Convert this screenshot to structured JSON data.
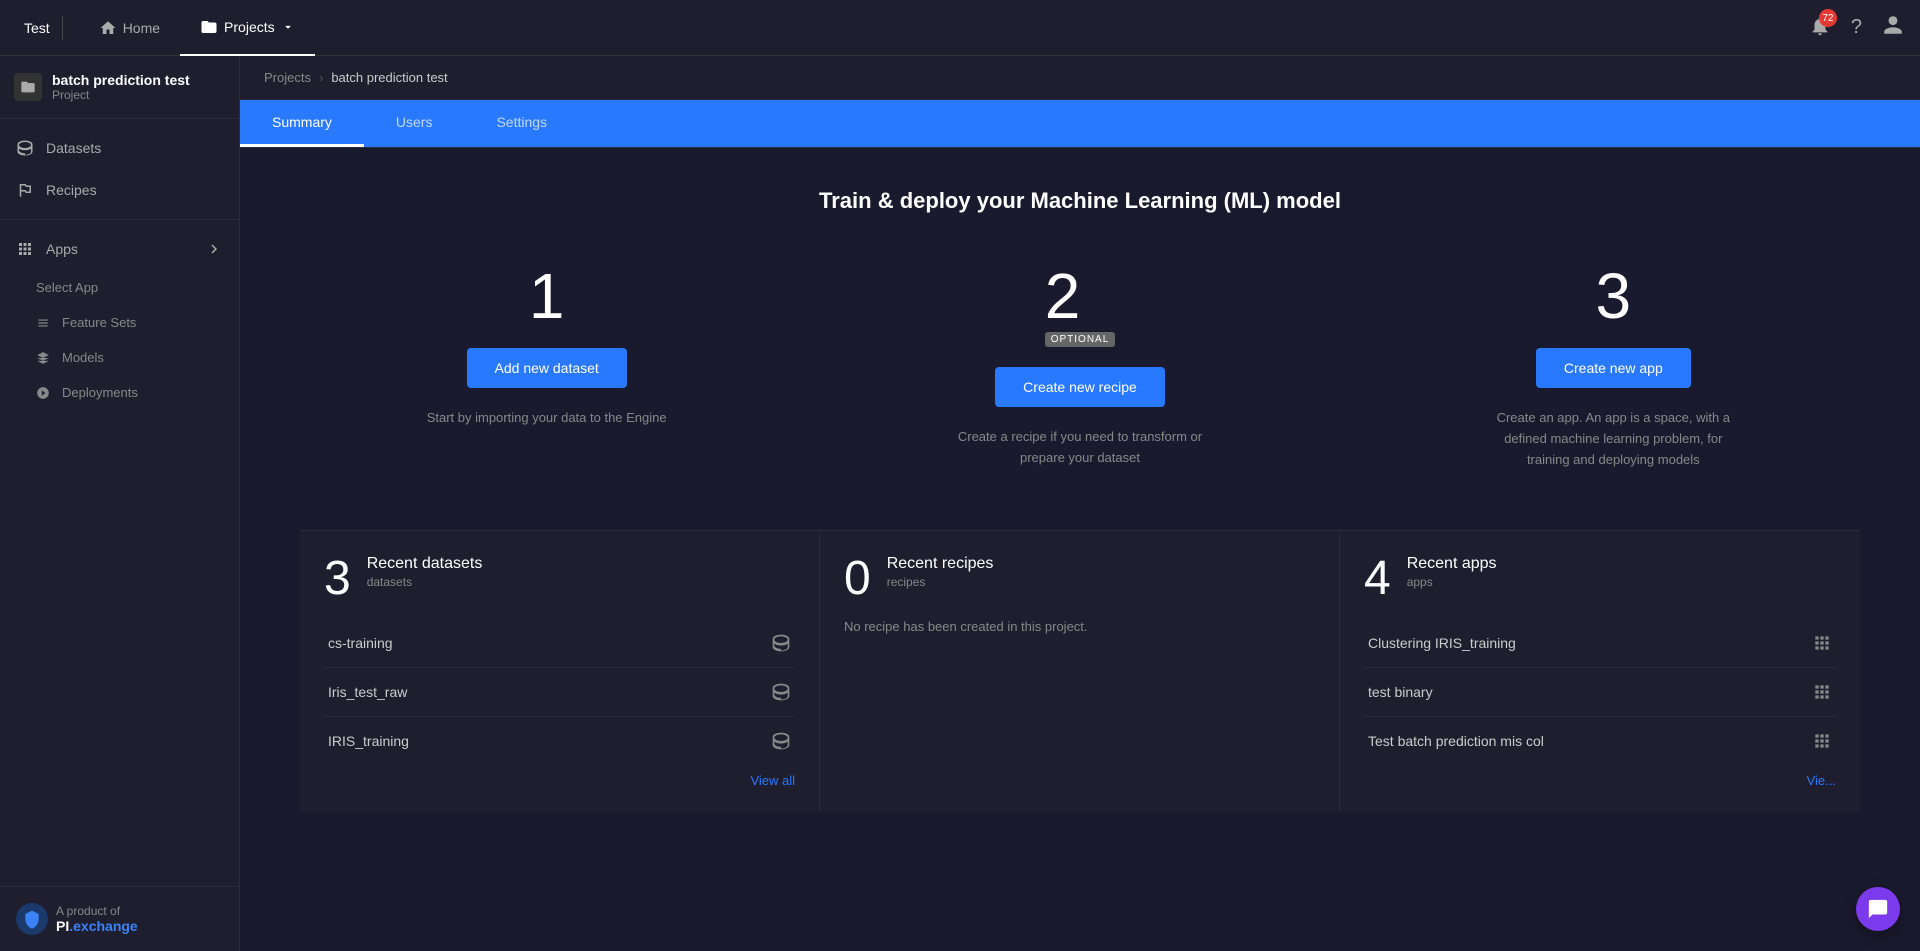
{
  "topnav": {
    "test_label": "Test",
    "home_label": "Home",
    "projects_label": "Projects",
    "notif_count": "72"
  },
  "sidebar": {
    "project_name": "batch prediction test",
    "project_label": "Project",
    "datasets_label": "Datasets",
    "recipes_label": "Recipes",
    "apps_label": "Apps",
    "apps_sub": "Select App",
    "feature_sets_label": "Feature Sets",
    "models_label": "Models",
    "deployments_label": "Deployments",
    "footer_text": "A product of",
    "logo_pi": "PI",
    "logo_exchange": ".exchange"
  },
  "breadcrumb": {
    "projects_link": "Projects",
    "current": "batch prediction test"
  },
  "tabs": {
    "summary": "Summary",
    "users": "Users",
    "settings": "Settings"
  },
  "summary": {
    "title": "Train & deploy your Machine Learning (ML) model",
    "step1_number": "1",
    "step1_btn": "Add new dataset",
    "step1_desc": "Start by importing your data to the Engine",
    "step2_number": "2",
    "step2_optional": "OPTIONAL",
    "step2_btn": "Create new recipe",
    "step2_desc": "Create a recipe if you need to transform or prepare your dataset",
    "step3_number": "3",
    "step3_btn": "Create new app",
    "step3_desc": "Create an app. An app is a space, with a defined machine learning problem, for training and deploying models"
  },
  "datasets_card": {
    "count": "3",
    "count_label": "datasets",
    "title": "Recent datasets",
    "items": [
      {
        "name": "cs-training"
      },
      {
        "name": "Iris_test_raw"
      },
      {
        "name": "IRIS_training"
      }
    ],
    "view_all": "View all"
  },
  "recipes_card": {
    "count": "0",
    "count_label": "recipes",
    "title": "Recent recipes",
    "no_recipe_msg": "No recipe has been created in this project."
  },
  "apps_card": {
    "count": "4",
    "count_label": "apps",
    "title": "Recent apps",
    "items": [
      {
        "name": "Clustering IRIS_training"
      },
      {
        "name": "test binary"
      },
      {
        "name": "Test batch prediction mis col"
      }
    ],
    "view_all": "Vie..."
  }
}
